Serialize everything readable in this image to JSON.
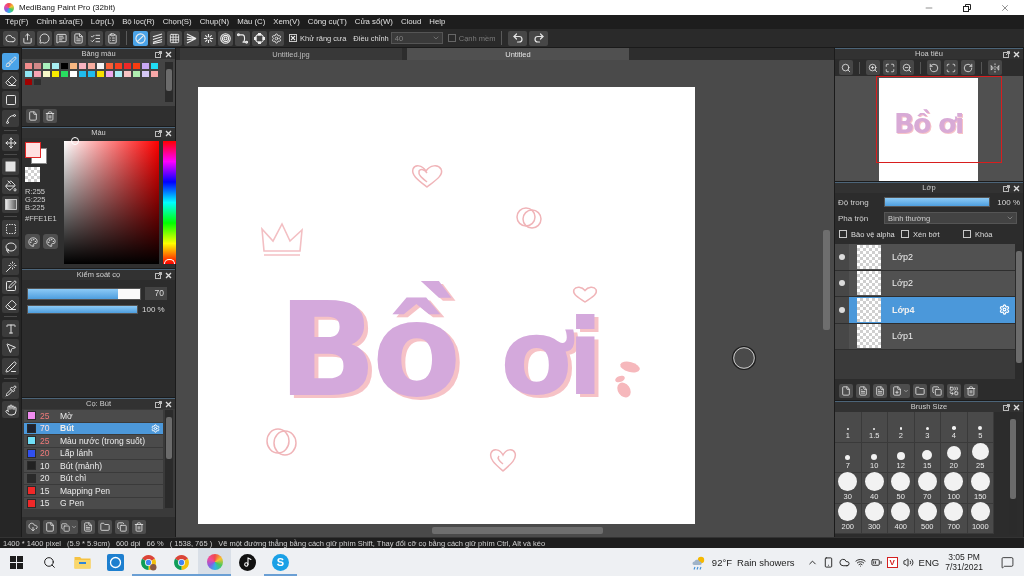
{
  "title_bar": {
    "title": "MediBang Paint Pro (32bit)"
  },
  "menu": [
    "Tệp(F)",
    "Chỉnh sửa(E)",
    "Lớp(L)",
    "Bộ lọc(R)",
    "Chọn(S)",
    "Chụp(N)",
    "Màu (C)",
    "Xem(V)",
    "Công cụ(T)",
    "Cửa sổ(W)",
    "Cloud",
    "Help"
  ],
  "toolbar": {
    "snap_tools": [
      {
        "kind": "off",
        "selected": true
      },
      {
        "kind": "parallel",
        "selected": false
      },
      {
        "kind": "grid",
        "selected": false
      },
      {
        "kind": "perspective",
        "selected": false
      },
      {
        "kind": "radial",
        "selected": false
      },
      {
        "kind": "concentric",
        "selected": false
      },
      {
        "kind": "curve",
        "selected": false
      },
      {
        "kind": "ellipse",
        "selected": false
      }
    ],
    "antialias": {
      "label": "Khử răng cưa",
      "checked": true
    },
    "correction": {
      "label": "Điều chỉnh",
      "value": "40",
      "disabled": true
    },
    "soft_edge": {
      "label": "Cạnh mềm",
      "checked": false,
      "disabled": true
    }
  },
  "tools": [
    [
      {
        "kind": "brush",
        "selected": true
      },
      {
        "kind": "eraser",
        "selected": false
      },
      {
        "kind": "shape",
        "selected": false
      },
      {
        "kind": "dot",
        "selected": false
      }
    ],
    [
      {
        "kind": "move",
        "selected": false
      }
    ],
    [
      {
        "kind": "fill",
        "selected": false
      },
      {
        "kind": "bucket",
        "selected": false
      },
      {
        "kind": "gradient",
        "selected": false
      }
    ],
    [
      {
        "kind": "select",
        "selected": false
      },
      {
        "kind": "lasso",
        "selected": false
      },
      {
        "kind": "wand",
        "selected": false
      },
      {
        "kind": "select_pen",
        "selected": false
      },
      {
        "kind": "select_eraser",
        "selected": false
      }
    ],
    [
      {
        "kind": "text",
        "selected": false
      },
      {
        "kind": "operation",
        "selected": false
      },
      {
        "kind": "divide",
        "selected": false
      }
    ],
    [
      {
        "kind": "eyedropper",
        "selected": false
      },
      {
        "kind": "hand",
        "selected": false
      }
    ]
  ],
  "palette": {
    "title": "Bảng màu",
    "swatches": [
      {
        "color": "#f28c8c"
      },
      {
        "color": "#d08888"
      },
      {
        "color": "#a8f0bc"
      },
      {
        "color": "#a8eef2"
      },
      {
        "color": "#000000"
      },
      {
        "color": "#f8b882"
      },
      {
        "color": "#f8b4c0"
      },
      {
        "color": "#f8aea0"
      },
      {
        "color": "#f4f4f4"
      },
      {
        "color": "#f86038"
      },
      {
        "color": "#f84020"
      },
      {
        "color": "#ee2828"
      },
      {
        "color": "#f83c10"
      },
      {
        "color": "#c8a8f4"
      },
      {
        "color": "#20dcf4"
      },
      {
        "color": "#90e6f4"
      },
      {
        "color": "#f8a4b4"
      },
      {
        "color": "#f8f8c8"
      },
      {
        "color": "#f8ec00"
      },
      {
        "color": "#28de60"
      },
      {
        "color": "#ffffff"
      },
      {
        "color": "#20bcee"
      },
      {
        "color": "#20bcef"
      },
      {
        "color": "#f8e000"
      },
      {
        "color": "#eea8ee"
      },
      {
        "color": "#a8eef4"
      },
      {
        "color": "#f8c4c4"
      },
      {
        "color": "#b0eeb0"
      },
      {
        "color": "#d6c8f6"
      },
      {
        "color": "#f8a8a8"
      },
      {
        "color": "#a00000"
      },
      {
        "color": "#2e2e2e"
      }
    ]
  },
  "color_panel": {
    "title": "Màu",
    "foreground": {
      "color": "#ffe1e1"
    },
    "background": {
      "color": "#ffffff"
    },
    "hue": {
      "level": 0
    },
    "r": "R:255",
    "g": "G:225",
    "b": "B:225",
    "hex": "#FFE1E1"
  },
  "brush_control": {
    "title": "Kiểm soát cọ",
    "size": {
      "level": 0.8,
      "value": "70"
    },
    "opacity": {
      "level": 1,
      "value": "100 %"
    }
  },
  "brush_list": {
    "title": "Cọ: Bút",
    "items": [
      {
        "name": "Mờ",
        "size": "25",
        "color": "#f08cf0",
        "size_tinted": true,
        "selected": false
      },
      {
        "name": "Bút",
        "size": "70",
        "color": "#1e2230",
        "size_tinted": true,
        "selected": true
      },
      {
        "name": "Màu nước (trong suốt)",
        "size": "25",
        "color": "#70e0f8",
        "size_tinted": true,
        "selected": false
      },
      {
        "name": "Lấp lánh",
        "size": "20",
        "color": "#3050f0",
        "size_tinted": true,
        "selected": false
      },
      {
        "name": "Bút (mảnh)",
        "size": "10",
        "color": "#222222",
        "size_tinted": false,
        "selected": false
      },
      {
        "name": "Bút chì",
        "size": "20",
        "color": "#2a2a2a",
        "size_tinted": false,
        "selected": false
      },
      {
        "name": "Mapping Pen",
        "size": "15",
        "color": "#f02828",
        "size_tinted": false,
        "selected": false
      },
      {
        "name": "G Pen",
        "size": "15",
        "color": "#f02829",
        "size_tinted": false,
        "selected": false
      }
    ]
  },
  "tabs": [
    {
      "label": "Untitled.jpg",
      "selected": false
    },
    {
      "label": "Untitled",
      "selected": true
    }
  ],
  "canvas": {
    "words": [
      "Bồ",
      "ơi"
    ]
  },
  "navigator": {
    "title": "Hoa tiêu",
    "preview_lettering": "Bồ ơi"
  },
  "layers": {
    "title": "Lớp",
    "opacity": {
      "label": "Độ trong",
      "level": 1,
      "value": "100 %"
    },
    "blend": {
      "label": "Pha trộn",
      "value": "Bình thường"
    },
    "options": [
      {
        "label": "Bảo vệ alpha",
        "checked": false
      },
      {
        "label": "Xén bớt",
        "checked": false
      },
      {
        "label": "Khóa",
        "checked": false
      }
    ],
    "items": [
      {
        "name": "Lớp2",
        "visible": true,
        "selected": false
      },
      {
        "name": "Lớp2",
        "visible": true,
        "selected": false
      },
      {
        "name": "Lớp4",
        "visible": true,
        "selected": true
      },
      {
        "name": "Lớp1",
        "visible": false,
        "selected": false
      }
    ]
  },
  "brush_size": {
    "title": "Brush Size",
    "sizes": [
      "1",
      "1.5",
      "2",
      "3",
      "4",
      "5",
      "7",
      "10",
      "12",
      "15",
      "20",
      "25",
      "30",
      "40",
      "50",
      "70",
      "100",
      "150",
      "200",
      "300",
      "400",
      "500",
      "700",
      "1000"
    ]
  },
  "status_bar": [
    "1400 * 1400 pixel",
    "(5.9 * 5.9cm)",
    "600 dpi",
    "66 %",
    "( 1538, 765 )",
    "Vẽ một đường thẳng bằng cách giữ phím Shift, Thay đổi cỡ cọ bằng cách giữ phím Ctrl, Alt và kéo"
  ],
  "taskbar": {
    "apps": [
      {
        "kind": "explorer",
        "running": false,
        "selected": false
      },
      {
        "kind": "dell",
        "running": false,
        "selected": false
      },
      {
        "kind": "chrome_profile",
        "running": true,
        "selected": false
      },
      {
        "kind": "chrome",
        "running": true,
        "selected": false
      },
      {
        "kind": "medibang",
        "running": true,
        "selected": true
      },
      {
        "kind": "tiktok",
        "running": false,
        "selected": false
      },
      {
        "kind": "skype",
        "running": true,
        "selected": false,
        "glyph": "S"
      }
    ],
    "weather": {
      "temperature": "92°F",
      "condition": "Rain showers"
    },
    "ime": "V",
    "language": "ENG",
    "time": "3:05 PM",
    "date": "7/31/2021"
  }
}
